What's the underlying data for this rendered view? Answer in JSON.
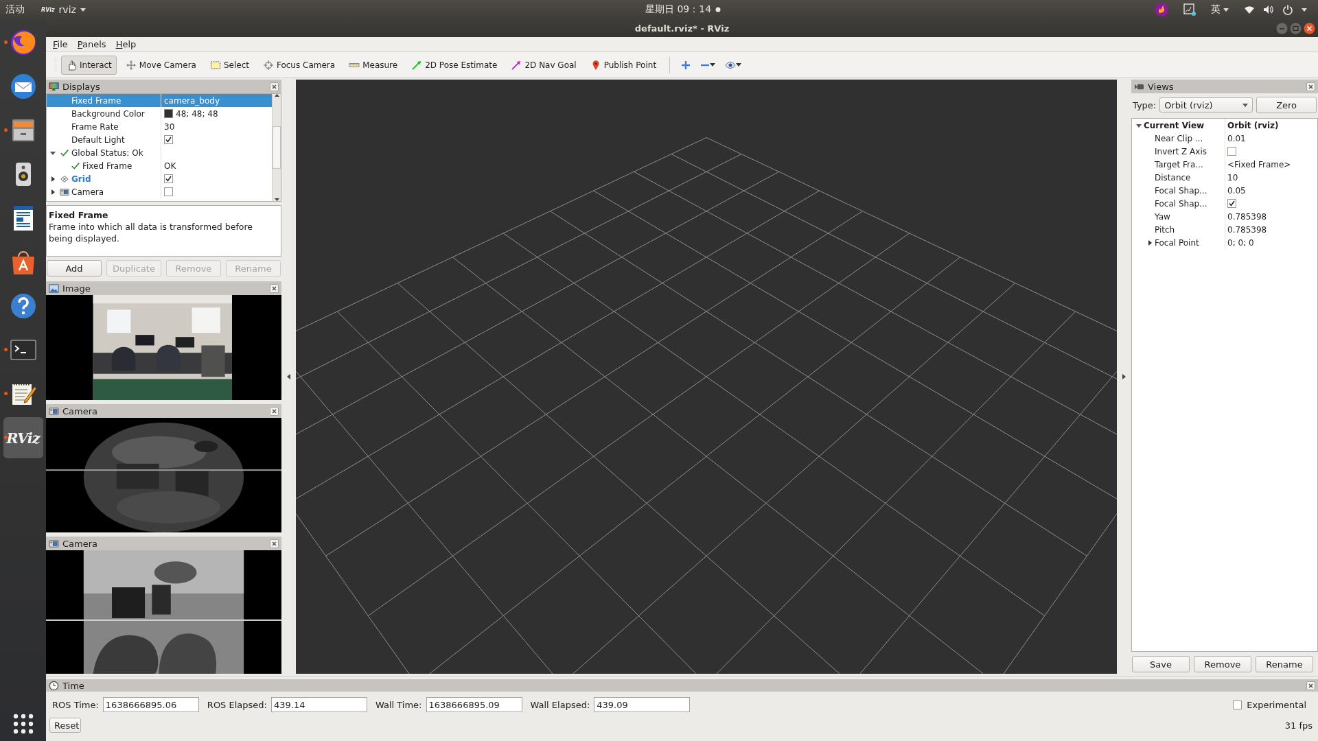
{
  "top_bar": {
    "activities": "活动",
    "app_menu": {
      "logo": "RViz",
      "label": "rviz"
    },
    "clock": "星期日 09：14",
    "input_method": "英"
  },
  "dock": {
    "apps": [
      {
        "kind": "browser",
        "running": true,
        "selected": false
      },
      {
        "kind": "mail",
        "running": false,
        "selected": false
      },
      {
        "kind": "files",
        "running": true,
        "selected": false
      },
      {
        "kind": "speaker",
        "running": false,
        "selected": false
      },
      {
        "kind": "document",
        "running": false,
        "selected": false
      },
      {
        "kind": "store",
        "running": false,
        "selected": false
      },
      {
        "kind": "help",
        "running": false,
        "selected": false
      },
      {
        "kind": "terminal",
        "running": true,
        "selected": false
      },
      {
        "kind": "editor",
        "running": true,
        "selected": false
      },
      {
        "kind": "rviz",
        "label": "RViz",
        "running": true,
        "selected": true
      }
    ]
  },
  "window": {
    "title": "default.rviz* - RViz"
  },
  "menu": [
    {
      "label": "File"
    },
    {
      "label": "Panels"
    },
    {
      "label": "Help"
    }
  ],
  "toolbar": [
    {
      "kind": "interact",
      "label": "Interact",
      "selected": true
    },
    {
      "kind": "move",
      "label": "Move Camera",
      "selected": false
    },
    {
      "kind": "select",
      "label": "Select",
      "selected": false
    },
    {
      "kind": "focus",
      "label": "Focus Camera",
      "selected": false
    },
    {
      "kind": "measure",
      "label": "Measure",
      "selected": false
    },
    {
      "kind": "pose",
      "label": "2D Pose Estimate",
      "selected": false
    },
    {
      "kind": "goal",
      "label": "2D Nav Goal",
      "selected": false
    },
    {
      "kind": "point",
      "label": "Publish Point",
      "selected": false
    }
  ],
  "displays": {
    "title": "Displays",
    "rows": [
      {
        "kind": "property",
        "name": "Fixed Frame",
        "value": "camera_body",
        "selected": true
      },
      {
        "kind": "property",
        "name": "Background Color",
        "value": "48; 48; 48",
        "color": "#303030",
        "selected": false
      },
      {
        "kind": "property",
        "name": "Frame Rate",
        "value": "30",
        "selected": false
      },
      {
        "kind": "property",
        "name": "Default Light",
        "checked": true,
        "selected": false
      },
      {
        "kind": "status",
        "name": "Global Status: Ok",
        "expanded": true,
        "selected": false,
        "children": [
          {
            "kind": "status",
            "name": "Fixed Frame",
            "value": "OK",
            "selected": false
          }
        ]
      },
      {
        "kind": "grid",
        "name": "Grid",
        "checked": true,
        "highlighted": true,
        "expanded": false,
        "selected": false
      },
      {
        "kind": "camera",
        "name": "Camera",
        "checked": false,
        "highlighted": false,
        "expanded": false,
        "selected": false
      }
    ],
    "description": {
      "title": "Fixed Frame",
      "text": "Frame into which all data is transformed before being displayed."
    },
    "buttons": [
      {
        "label": "Add",
        "disabled": false
      },
      {
        "label": "Duplicate",
        "disabled": true
      },
      {
        "label": "Remove",
        "disabled": true
      },
      {
        "label": "Rename",
        "disabled": true
      }
    ]
  },
  "image_panels": [
    {
      "title": "Image",
      "kind": "picture"
    },
    {
      "title": "Camera",
      "kind": "picture"
    },
    {
      "title": "Camera",
      "kind": "picture"
    }
  ],
  "views": {
    "title": "Views",
    "type_label": "Type:",
    "type_value": "Orbit (rviz)",
    "zero_button": "Zero",
    "rows": [
      {
        "name": "Current View",
        "value": "Orbit (rviz)",
        "expanded": true,
        "selected": false,
        "children": [
          {
            "name": "Near Clip ...",
            "value": "0.01",
            "selected": false
          },
          {
            "name": "Invert Z Axis",
            "checked": false,
            "selected": false
          },
          {
            "name": "Target Fra...",
            "value": "<Fixed Frame>",
            "selected": false
          },
          {
            "name": "Distance",
            "value": "10",
            "selected": false
          },
          {
            "name": "Focal Shap...",
            "value": "0.05",
            "selected": false
          },
          {
            "name": "Focal Shap...",
            "checked": true,
            "selected": false
          },
          {
            "name": "Yaw",
            "value": "0.785398",
            "selected": false
          },
          {
            "name": "Pitch",
            "value": "0.785398",
            "selected": false
          },
          {
            "name": "Focal Point",
            "value": "0; 0; 0",
            "expanded": false,
            "selected": false
          }
        ]
      }
    ],
    "buttons": [
      {
        "label": "Save"
      },
      {
        "label": "Remove"
      },
      {
        "label": "Rename"
      }
    ]
  },
  "time": {
    "title": "Time",
    "fields": [
      {
        "label": "ROS Time:",
        "value": "1638666895.06"
      },
      {
        "label": "ROS Elapsed:",
        "value": "439.14"
      },
      {
        "label": "Wall Time:",
        "value": "1638666895.09"
      },
      {
        "label": "Wall Elapsed:",
        "value": "439.09"
      }
    ],
    "experimental": {
      "label": "Experimental",
      "checked": false
    },
    "reset": "Reset",
    "fps": "31 fps"
  }
}
